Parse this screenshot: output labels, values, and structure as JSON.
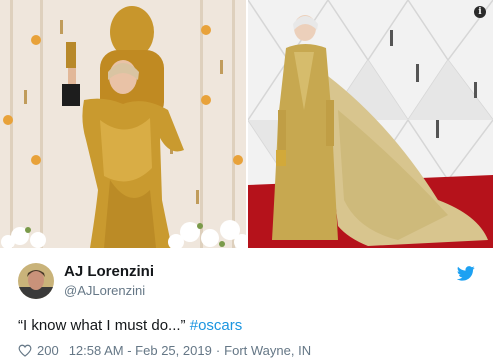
{
  "tweet": {
    "name": "AJ Lorenzini",
    "handle": "@AJLorenzini",
    "text": "“I know what I must do...” ",
    "hashtag": "#oscars",
    "likes": "200",
    "timestamp": "12:58 AM - Feb 25, 2019",
    "separator": "·",
    "location": "Fort Wayne, IN",
    "info_glyph": "i"
  },
  "colors": {
    "twitter_blue": "#1da1f2",
    "hashtag": "#1b95e0",
    "secondary_text": "#657786",
    "gold": "#c9a227",
    "carpet_red": "#b5121b"
  },
  "icons": [
    "info-icon",
    "twitter-bird-icon",
    "heart-icon"
  ]
}
